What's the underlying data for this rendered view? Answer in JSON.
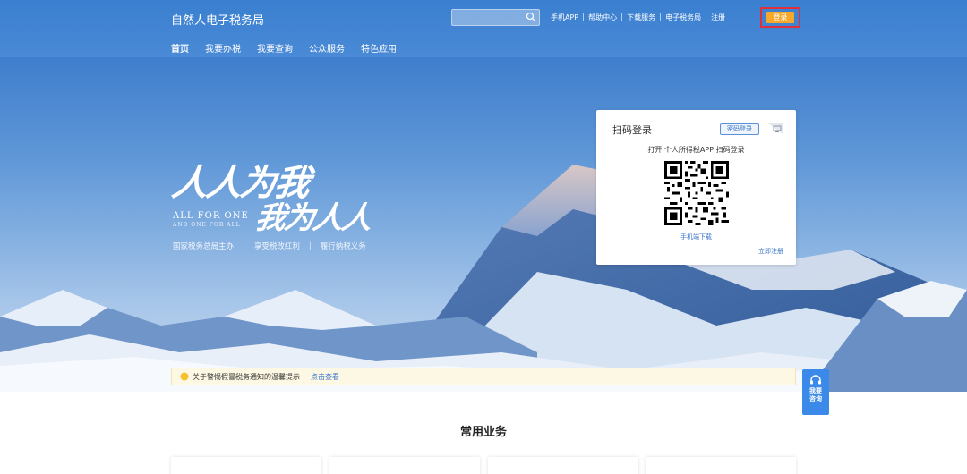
{
  "header": {
    "site_title": "自然人电子税务局",
    "search_placeholder": "",
    "top_links": [
      "手机APP",
      "帮助中心",
      "下载服务",
      "电子税务局",
      "注册"
    ],
    "login_label": "登录",
    "nav_tabs": [
      "首页",
      "我要办税",
      "我要查询",
      "公众服务",
      "特色应用"
    ],
    "active_tab": "首页"
  },
  "hero": {
    "slogan_line1": "人人为我",
    "slogan_line2": "我为人人",
    "english_line1": "ALL FOR ONE",
    "english_line2": "AND ONE FOR ALL",
    "sub_items": [
      "国家税务总局主办",
      "享受税改红利",
      "履行纳税义务"
    ]
  },
  "login_card": {
    "title": "扫码登录",
    "password_tag": "密码登录",
    "scan_hint": "打开 个人所得税APP 扫码登录",
    "download_link": "手机端下载",
    "register_link": "立即注册"
  },
  "notice": {
    "text": "关于警惕假冒税务通知的温馨提示",
    "link": "点击查看"
  },
  "float_help": {
    "line1": "我要",
    "line2": "咨询"
  },
  "section": {
    "title": "常用业务"
  },
  "colors": {
    "header_blue": "#3a7fd0",
    "login_orange": "#f5a82a",
    "highlight_red": "#e0303a",
    "link_blue": "#3a74c9",
    "float_blue": "#3b8aea"
  }
}
